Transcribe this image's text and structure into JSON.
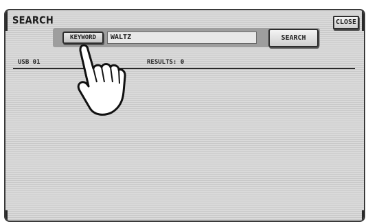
{
  "window": {
    "title": "SEARCH"
  },
  "toolbar": {
    "close_label": "CLOSE"
  },
  "search": {
    "keyword_button_label": "KEYWORD",
    "keyword_value": "WALTZ",
    "search_button_label": "SEARCH"
  },
  "status": {
    "location": "USB 01",
    "results_label": "RESULTS:",
    "results_count": "0"
  },
  "overlay": {
    "icon": "pointing-hand-icon"
  }
}
